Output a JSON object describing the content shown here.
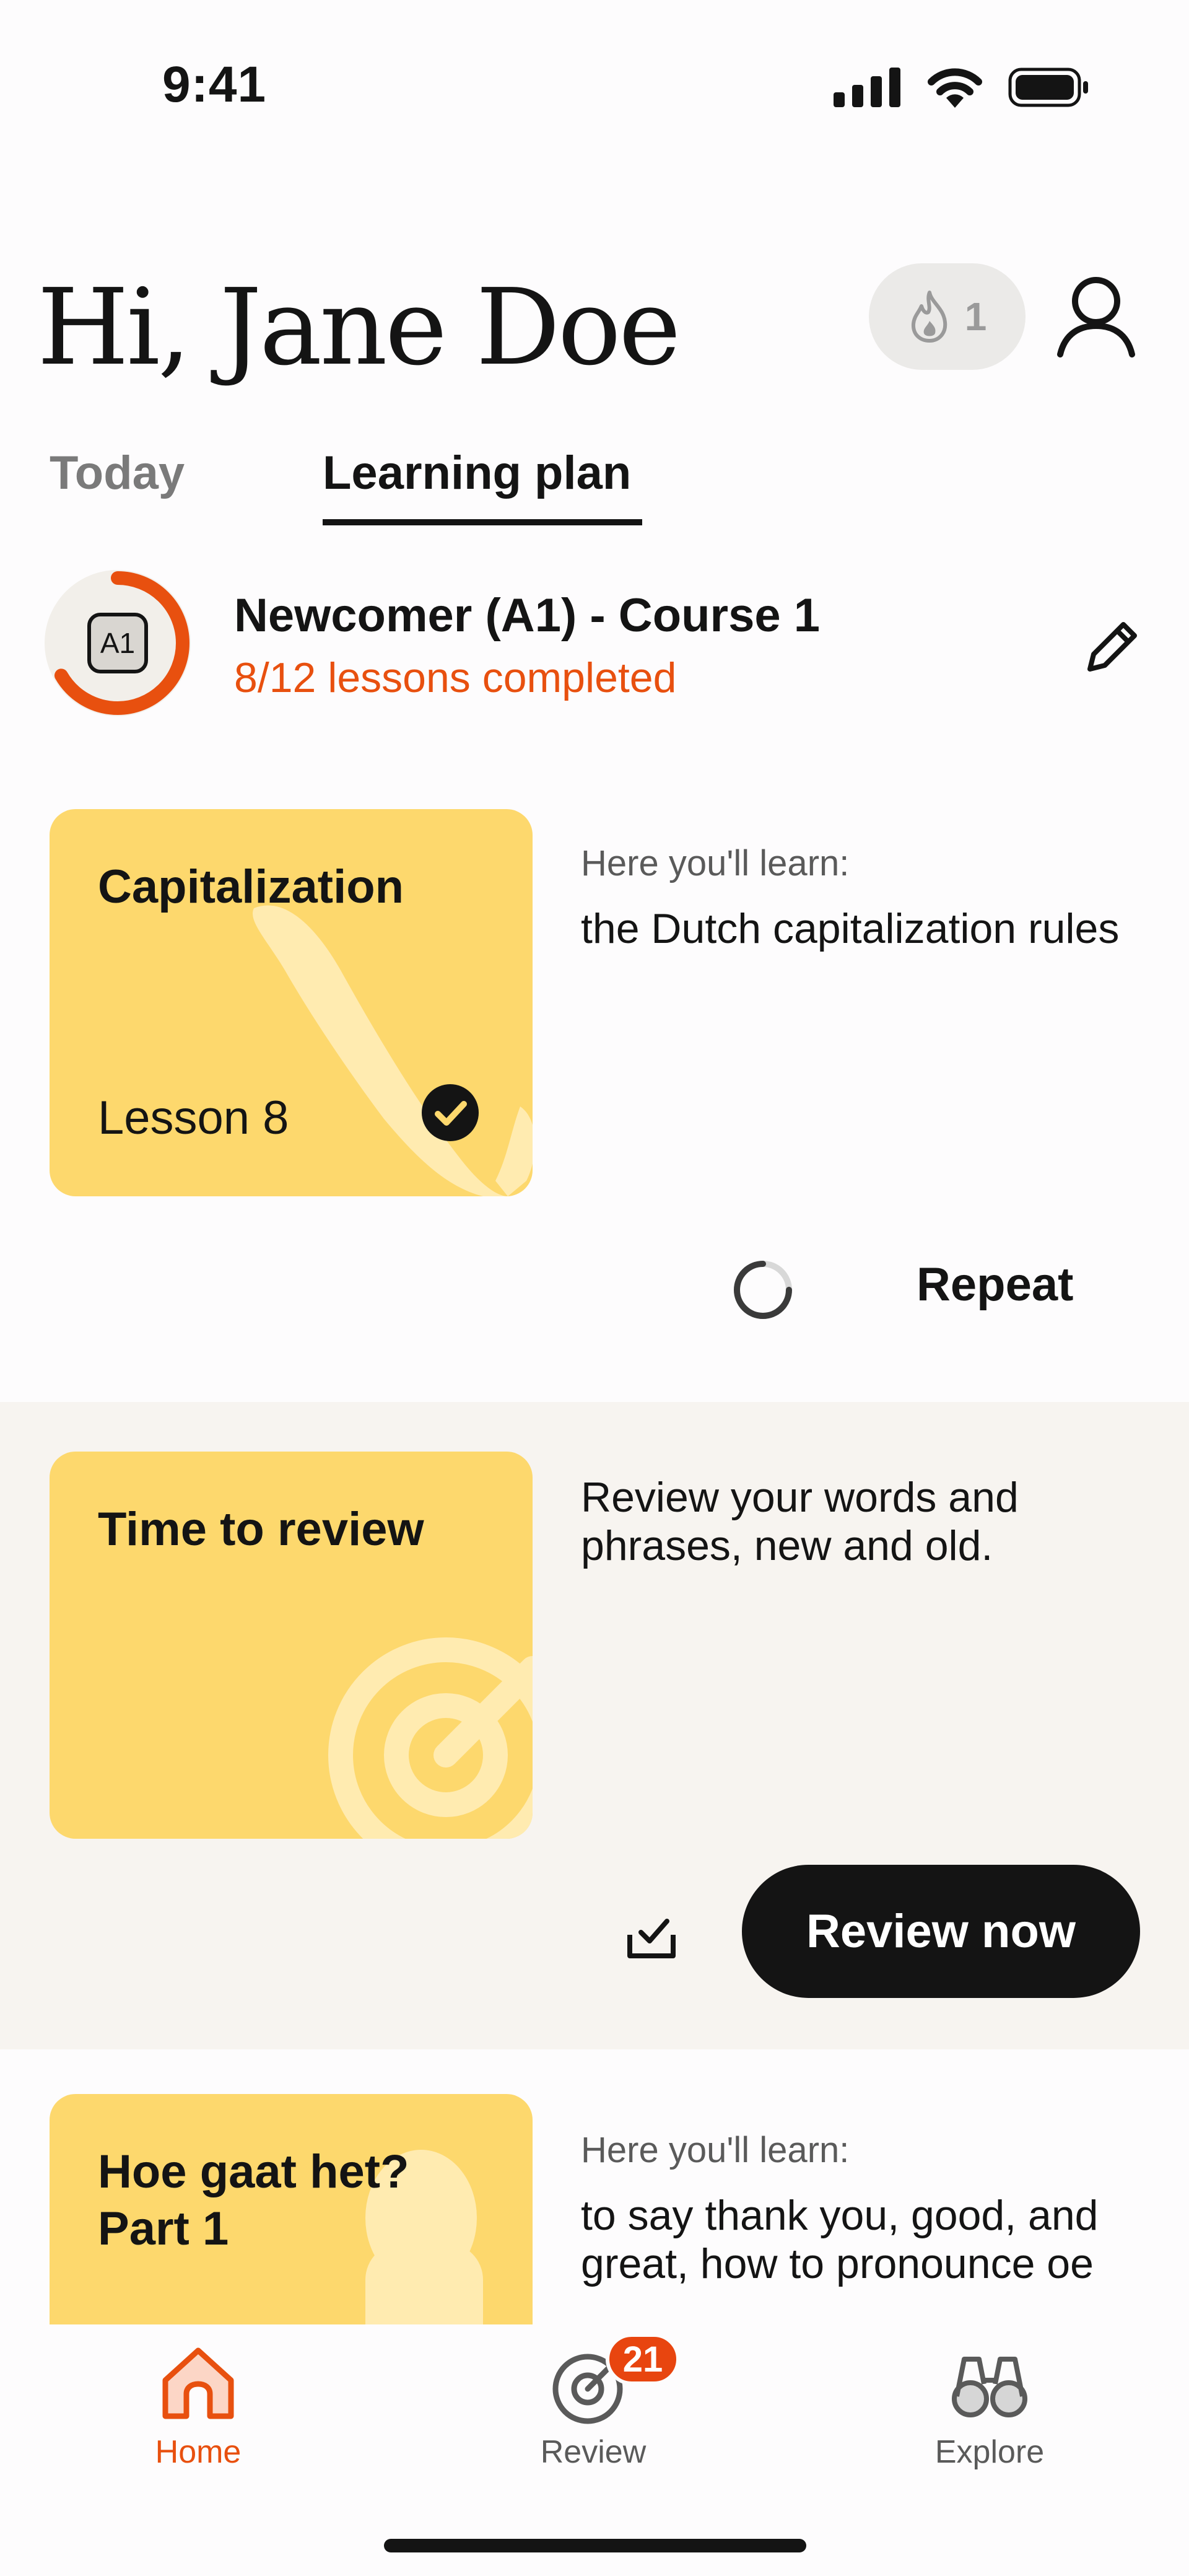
{
  "status_bar": {
    "time": "9:41"
  },
  "header": {
    "greeting": "Hi, Jane Doe",
    "streak_count": "1",
    "icons": {
      "streak": "flame-icon",
      "profile": "user-icon"
    }
  },
  "tabs": [
    {
      "label": "Today",
      "active": false
    },
    {
      "label": "Learning plan",
      "active": true
    }
  ],
  "course": {
    "level_badge": "A1",
    "title": "Newcomer (A1) - Course 1",
    "progress_text": "8/12 lessons completed",
    "completed": 8,
    "total": 12,
    "accent_color": "#E8500F"
  },
  "lessons": [
    {
      "title": "Capitalization",
      "lesson_label": "Lesson 8",
      "completed": true,
      "desc_label": "Here you'll learn:",
      "desc": "the Dutch capitalization rules",
      "action": "Repeat"
    },
    {
      "title": "Time to review",
      "desc": "Review your words and phrases, new and old.",
      "action": "Review now"
    },
    {
      "title": "Hoe gaat het? Part 1",
      "desc_label": "Here you'll learn:",
      "desc": "to say thank you, good, and great, how to pronounce oe"
    }
  ],
  "bottom_nav": [
    {
      "label": "Home",
      "icon": "home-icon",
      "active": true
    },
    {
      "label": "Review",
      "icon": "target-icon",
      "badge": "21"
    },
    {
      "label": "Explore",
      "icon": "binoculars-icon"
    }
  ],
  "colors": {
    "card": "#FDD86D",
    "accent": "#E8500F",
    "review_bg": "#F7F4F0"
  }
}
